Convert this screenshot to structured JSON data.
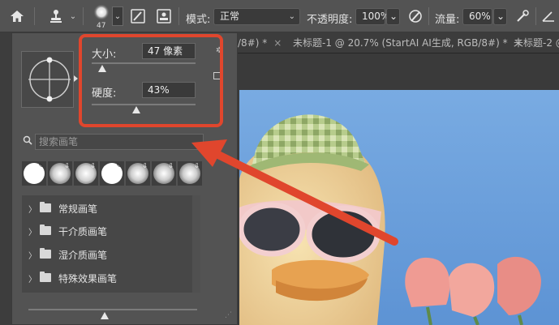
{
  "toolbar": {
    "brush_size_number": "47",
    "mode_label": "模式:",
    "mode_value": "正常",
    "opacity_label": "不透明度:",
    "opacity_value": "100%",
    "flow_label": "流量:",
    "flow_value": "60%"
  },
  "tabs": [
    {
      "label": "/8#) *",
      "close": "×"
    },
    {
      "label": "未标题-1 @ 20.7% (StartAI AI生成, RGB/8#) *",
      "close": "×"
    },
    {
      "label": "未标题-2 @",
      "close": ""
    }
  ],
  "panel": {
    "size_label": "大小:",
    "size_value": "47 像素",
    "size_slider_percent": 10,
    "hardness_label": "硬度:",
    "hardness_value": "43%",
    "hardness_slider_percent": 43,
    "search_placeholder": "搜索画笔",
    "groups": [
      {
        "label": "常规画笔"
      },
      {
        "label": "干介质画笔"
      },
      {
        "label": "湿介质画笔"
      },
      {
        "label": "特殊效果画笔"
      }
    ],
    "bottom_slider_percent": 45
  },
  "colors": {
    "highlight": "#e0462d",
    "sky": "#6fa3dd"
  }
}
